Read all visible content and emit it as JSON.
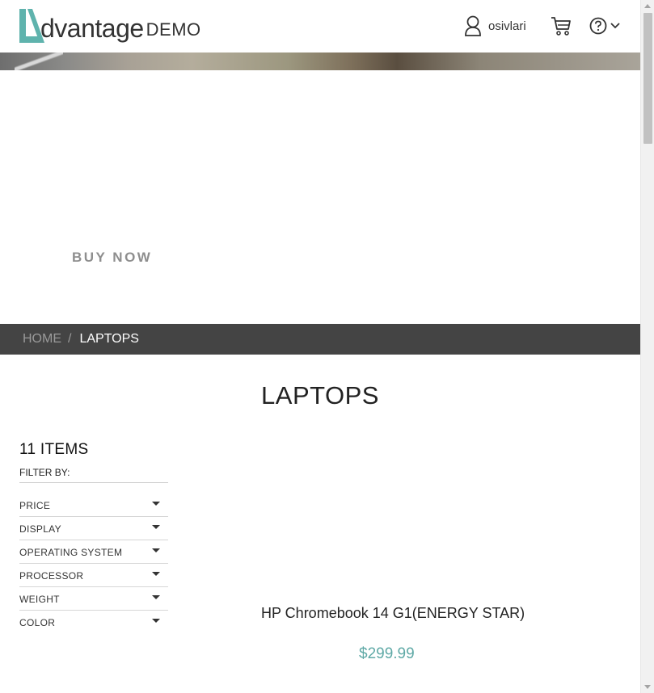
{
  "header": {
    "logo_text": "dvantage",
    "logo_demo": "DEMO",
    "username": "osivlari",
    "icons": {
      "user": "user-icon",
      "cart": "cart-icon",
      "help": "help-icon",
      "dropdown": "chevron-down-icon"
    },
    "brand_color": "#5fb3ad"
  },
  "banner": {
    "cta_label": "BUY NOW"
  },
  "breadcrumb": {
    "home": "HOME",
    "separator": "/",
    "current": "LAPTOPS"
  },
  "page": {
    "title": "LAPTOPS"
  },
  "filters": {
    "count_label": "11 ITEMS",
    "filter_by_label": "FILTER BY:",
    "items": [
      {
        "label": "PRICE"
      },
      {
        "label": "DISPLAY"
      },
      {
        "label": "OPERATING SYSTEM"
      },
      {
        "label": "PROCESSOR"
      },
      {
        "label": "WEIGHT"
      },
      {
        "label": "COLOR"
      }
    ]
  },
  "product": {
    "name": "HP Chromebook 14 G1(ENERGY STAR)",
    "price": "$299.99",
    "price_color": "#5fa9a6"
  }
}
